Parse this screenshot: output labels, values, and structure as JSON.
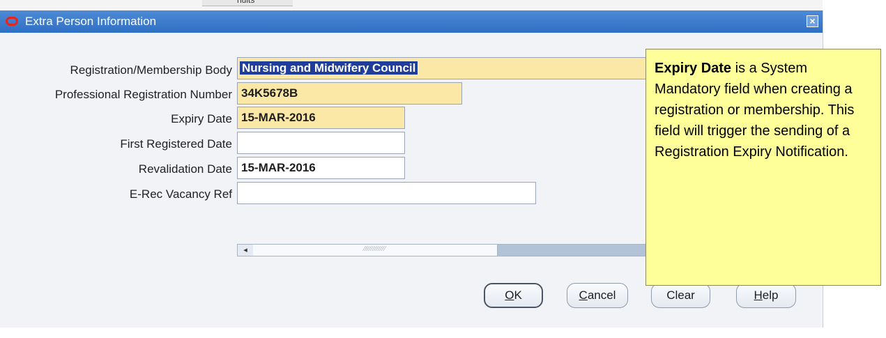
{
  "background_window": {
    "tab_label": "nuits"
  },
  "dialog": {
    "title": "Extra Person Information",
    "close_icon": "close-icon",
    "logo_icon": "oracle-logo-icon",
    "colors": {
      "titlebar": "#3a7bd0",
      "required_field": "#fbe7a6",
      "selection": "#1f3e9c"
    }
  },
  "fields": {
    "registration_body": {
      "label": "Registration/Membership Body",
      "value": "Nursing and Midwifery Council"
    },
    "registration_number": {
      "label": "Professional Registration Number",
      "value": "34K5678B"
    },
    "expiry_date": {
      "label": "Expiry Date",
      "value": "15-MAR-2016"
    },
    "first_registered_date": {
      "label": "First Registered Date",
      "value": ""
    },
    "revalidation_date": {
      "label": "Revalidation Date",
      "value": "15-MAR-2016"
    },
    "erec_vacancy_ref": {
      "label": "E-Rec Vacancy Ref",
      "value": ""
    }
  },
  "scrollbar": {
    "left_arrow": "◂",
    "thumb_grip": "⁄⁄⁄⁄⁄⁄⁄⁄⁄⁄⁄⁄"
  },
  "buttons": {
    "ok": {
      "mnemonic": "O",
      "rest": "K"
    },
    "cancel": {
      "mnemonic": "C",
      "rest": "ancel"
    },
    "clear": {
      "label": "Clear"
    },
    "help": {
      "mnemonic": "H",
      "rest": "elp"
    }
  },
  "callout": {
    "bold": "Expiry Date",
    "text": " is a System Mandatory field when creating a registration or membership.  This field will trigger the sending of a Registration Expiry Notification."
  }
}
